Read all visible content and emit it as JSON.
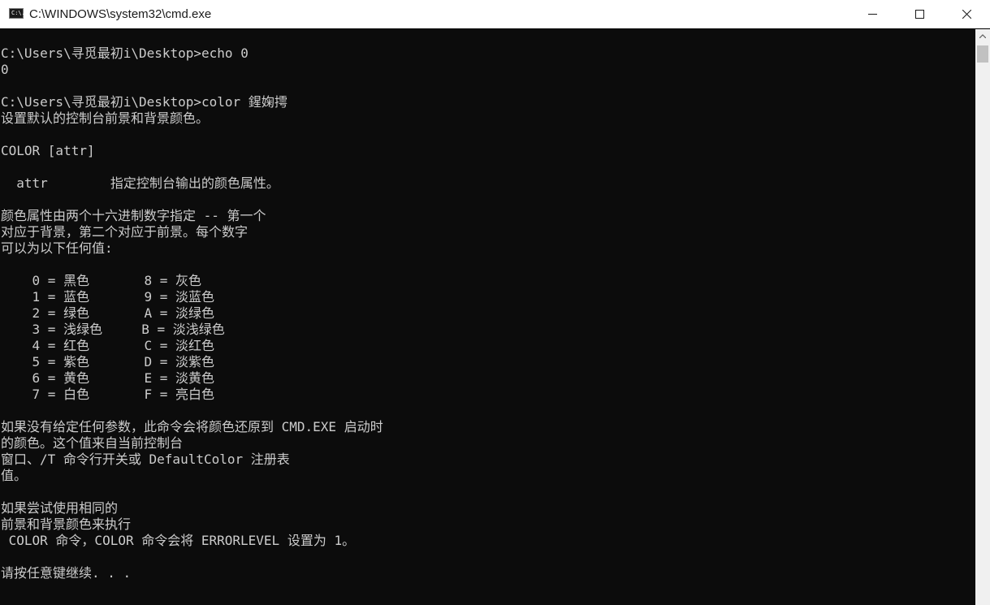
{
  "window": {
    "title": "C:\\WINDOWS\\system32\\cmd.exe",
    "app_icon_glyph": "C:\\.",
    "icon": "cmd-console-icon",
    "controls": {
      "minimize_icon": "minimize-icon",
      "maximize_icon": "maximize-icon",
      "close_icon": "close-icon"
    }
  },
  "console": {
    "background_color": "#0c0c0c",
    "text_color": "#cccccc",
    "lines": [
      "C:\\Users\\寻觅最初i\\Desktop>echo 0",
      "0",
      "",
      "C:\\Users\\寻觅最初i\\Desktop>color 鍟婅摴",
      "设置默认的控制台前景和背景颜色。",
      "",
      "COLOR [attr]",
      "",
      "  attr        指定控制台输出的颜色属性。",
      "",
      "颜色属性由两个十六进制数字指定 -- 第一个",
      "对应于背景，第二个对应于前景。每个数字",
      "可以为以下任何值:",
      "",
      "    0 = 黑色       8 = 灰色",
      "    1 = 蓝色       9 = 淡蓝色",
      "    2 = 绿色       A = 淡绿色",
      "    3 = 浅绿色     B = 淡浅绿色",
      "    4 = 红色       C = 淡红色",
      "    5 = 紫色       D = 淡紫色",
      "    6 = 黄色       E = 淡黄色",
      "    7 = 白色       F = 亮白色",
      "",
      "如果没有给定任何参数，此命令会将颜色还原到 CMD.EXE 启动时",
      "的颜色。这个值来自当前控制台",
      "窗口、/T 命令行开关或 DefaultColor 注册表",
      "值。",
      "",
      "如果尝试使用相同的",
      "前景和背景颜色来执行",
      " COLOR 命令，COLOR 命令会将 ERRORLEVEL 设置为 1。",
      "",
      "请按任意键继续. . ."
    ]
  },
  "scrollbar": {
    "up_icon": "scroll-up-arrow-icon"
  }
}
